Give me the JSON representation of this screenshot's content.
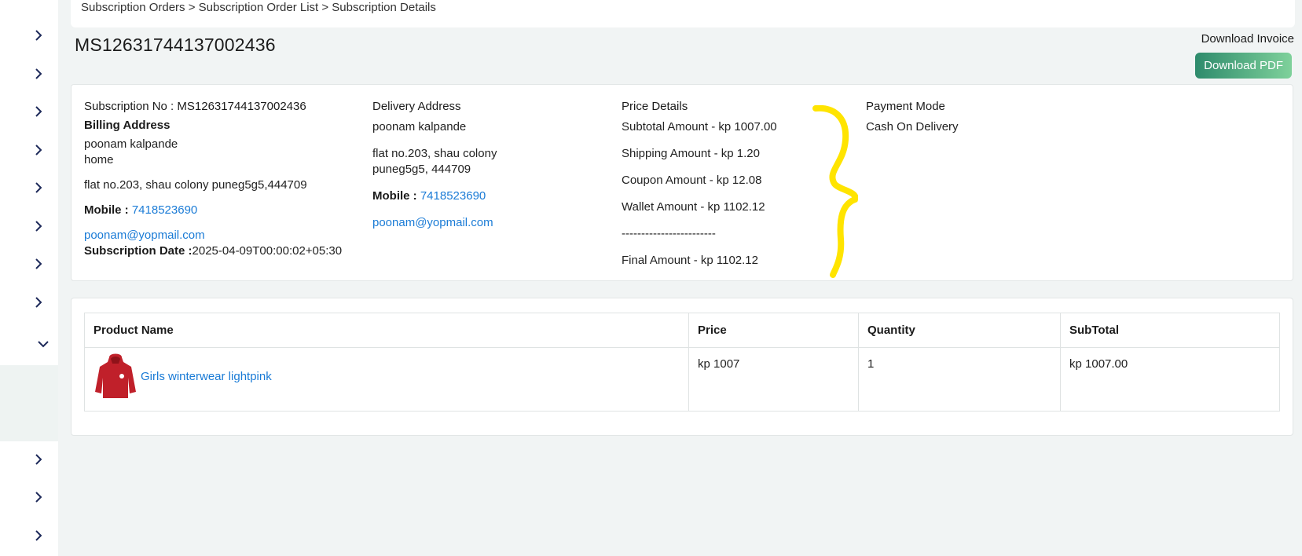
{
  "breadcrumb": {
    "text": "Subscription Orders > Subscription Order List > Subscription Details"
  },
  "header": {
    "order_id": "MS12631744137002436",
    "download_label": "Download Invoice",
    "download_button": "Download PDF"
  },
  "subscription": {
    "number_label": "Subscription No : MS12631744137002436",
    "billing_title": "Billing Address",
    "billing_name": "poonam kalpande",
    "billing_type": "home",
    "billing_address": "flat no.203, shau colony puneg5g5,444709",
    "mobile_label": "Mobile :",
    "mobile": "7418523690",
    "email": "poonam@yopmail.com",
    "date_label": "Subscription Date :",
    "date": "2025-04-09T00:00:02+05:30"
  },
  "delivery": {
    "title": "Delivery Address",
    "name": "poonam kalpande",
    "address_line1": "flat no.203, shau colony",
    "address_line2": "puneg5g5, 444709",
    "mobile_label": "Mobile :",
    "mobile": "7418523690",
    "email": "poonam@yopmail.com"
  },
  "price": {
    "title": "Price Details",
    "subtotal": "Subtotal Amount - kp 1007.00",
    "shipping": "Shipping Amount - kp 1.20",
    "coupon": "Coupon Amount - kp 12.08",
    "wallet": "Wallet Amount - kp 1102.12",
    "divider": "------------------------",
    "final": "Final Amount - kp  1102.12"
  },
  "payment": {
    "title": "Payment Mode",
    "mode": "Cash On Delivery"
  },
  "table": {
    "headers": [
      "Product Name",
      "Price",
      "Quantity",
      "SubTotal"
    ],
    "rows": [
      {
        "name": "Girls winterwear lightpink",
        "price": "kp 1007",
        "quantity": "1",
        "subtotal": "kp 1007.00"
      }
    ]
  },
  "colors": {
    "accent_link": "#1a7bd6",
    "button_start": "#2e8b6c",
    "button_end": "#7fd19b",
    "annotation": "#ffe400",
    "product_red": "#c0202a"
  },
  "icons": {
    "sidebar_collapsed": "chevron-right-icon",
    "sidebar_expanded": "chevron-down-icon"
  }
}
